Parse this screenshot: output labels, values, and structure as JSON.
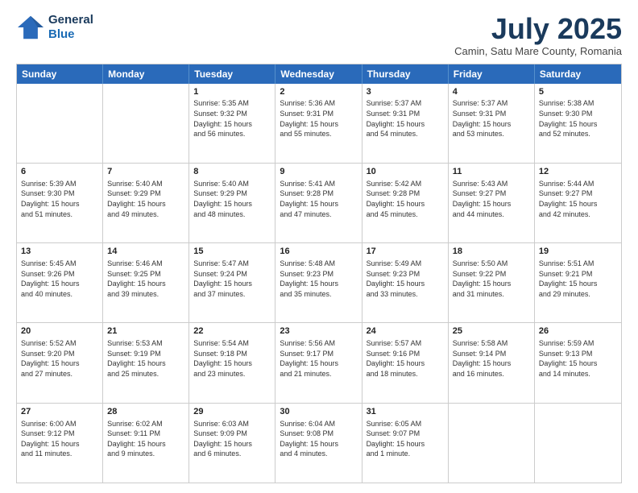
{
  "header": {
    "logo_line1": "General",
    "logo_line2": "Blue",
    "month": "July 2025",
    "location": "Camin, Satu Mare County, Romania"
  },
  "days_of_week": [
    "Sunday",
    "Monday",
    "Tuesday",
    "Wednesday",
    "Thursday",
    "Friday",
    "Saturday"
  ],
  "weeks": [
    [
      {
        "day": "",
        "info": ""
      },
      {
        "day": "",
        "info": ""
      },
      {
        "day": "1",
        "info": "Sunrise: 5:35 AM\nSunset: 9:32 PM\nDaylight: 15 hours\nand 56 minutes."
      },
      {
        "day": "2",
        "info": "Sunrise: 5:36 AM\nSunset: 9:31 PM\nDaylight: 15 hours\nand 55 minutes."
      },
      {
        "day": "3",
        "info": "Sunrise: 5:37 AM\nSunset: 9:31 PM\nDaylight: 15 hours\nand 54 minutes."
      },
      {
        "day": "4",
        "info": "Sunrise: 5:37 AM\nSunset: 9:31 PM\nDaylight: 15 hours\nand 53 minutes."
      },
      {
        "day": "5",
        "info": "Sunrise: 5:38 AM\nSunset: 9:30 PM\nDaylight: 15 hours\nand 52 minutes."
      }
    ],
    [
      {
        "day": "6",
        "info": "Sunrise: 5:39 AM\nSunset: 9:30 PM\nDaylight: 15 hours\nand 51 minutes."
      },
      {
        "day": "7",
        "info": "Sunrise: 5:40 AM\nSunset: 9:29 PM\nDaylight: 15 hours\nand 49 minutes."
      },
      {
        "day": "8",
        "info": "Sunrise: 5:40 AM\nSunset: 9:29 PM\nDaylight: 15 hours\nand 48 minutes."
      },
      {
        "day": "9",
        "info": "Sunrise: 5:41 AM\nSunset: 9:28 PM\nDaylight: 15 hours\nand 47 minutes."
      },
      {
        "day": "10",
        "info": "Sunrise: 5:42 AM\nSunset: 9:28 PM\nDaylight: 15 hours\nand 45 minutes."
      },
      {
        "day": "11",
        "info": "Sunrise: 5:43 AM\nSunset: 9:27 PM\nDaylight: 15 hours\nand 44 minutes."
      },
      {
        "day": "12",
        "info": "Sunrise: 5:44 AM\nSunset: 9:27 PM\nDaylight: 15 hours\nand 42 minutes."
      }
    ],
    [
      {
        "day": "13",
        "info": "Sunrise: 5:45 AM\nSunset: 9:26 PM\nDaylight: 15 hours\nand 40 minutes."
      },
      {
        "day": "14",
        "info": "Sunrise: 5:46 AM\nSunset: 9:25 PM\nDaylight: 15 hours\nand 39 minutes."
      },
      {
        "day": "15",
        "info": "Sunrise: 5:47 AM\nSunset: 9:24 PM\nDaylight: 15 hours\nand 37 minutes."
      },
      {
        "day": "16",
        "info": "Sunrise: 5:48 AM\nSunset: 9:23 PM\nDaylight: 15 hours\nand 35 minutes."
      },
      {
        "day": "17",
        "info": "Sunrise: 5:49 AM\nSunset: 9:23 PM\nDaylight: 15 hours\nand 33 minutes."
      },
      {
        "day": "18",
        "info": "Sunrise: 5:50 AM\nSunset: 9:22 PM\nDaylight: 15 hours\nand 31 minutes."
      },
      {
        "day": "19",
        "info": "Sunrise: 5:51 AM\nSunset: 9:21 PM\nDaylight: 15 hours\nand 29 minutes."
      }
    ],
    [
      {
        "day": "20",
        "info": "Sunrise: 5:52 AM\nSunset: 9:20 PM\nDaylight: 15 hours\nand 27 minutes."
      },
      {
        "day": "21",
        "info": "Sunrise: 5:53 AM\nSunset: 9:19 PM\nDaylight: 15 hours\nand 25 minutes."
      },
      {
        "day": "22",
        "info": "Sunrise: 5:54 AM\nSunset: 9:18 PM\nDaylight: 15 hours\nand 23 minutes."
      },
      {
        "day": "23",
        "info": "Sunrise: 5:56 AM\nSunset: 9:17 PM\nDaylight: 15 hours\nand 21 minutes."
      },
      {
        "day": "24",
        "info": "Sunrise: 5:57 AM\nSunset: 9:16 PM\nDaylight: 15 hours\nand 18 minutes."
      },
      {
        "day": "25",
        "info": "Sunrise: 5:58 AM\nSunset: 9:14 PM\nDaylight: 15 hours\nand 16 minutes."
      },
      {
        "day": "26",
        "info": "Sunrise: 5:59 AM\nSunset: 9:13 PM\nDaylight: 15 hours\nand 14 minutes."
      }
    ],
    [
      {
        "day": "27",
        "info": "Sunrise: 6:00 AM\nSunset: 9:12 PM\nDaylight: 15 hours\nand 11 minutes."
      },
      {
        "day": "28",
        "info": "Sunrise: 6:02 AM\nSunset: 9:11 PM\nDaylight: 15 hours\nand 9 minutes."
      },
      {
        "day": "29",
        "info": "Sunrise: 6:03 AM\nSunset: 9:09 PM\nDaylight: 15 hours\nand 6 minutes."
      },
      {
        "day": "30",
        "info": "Sunrise: 6:04 AM\nSunset: 9:08 PM\nDaylight: 15 hours\nand 4 minutes."
      },
      {
        "day": "31",
        "info": "Sunrise: 6:05 AM\nSunset: 9:07 PM\nDaylight: 15 hours\nand 1 minute."
      },
      {
        "day": "",
        "info": ""
      },
      {
        "day": "",
        "info": ""
      }
    ]
  ]
}
